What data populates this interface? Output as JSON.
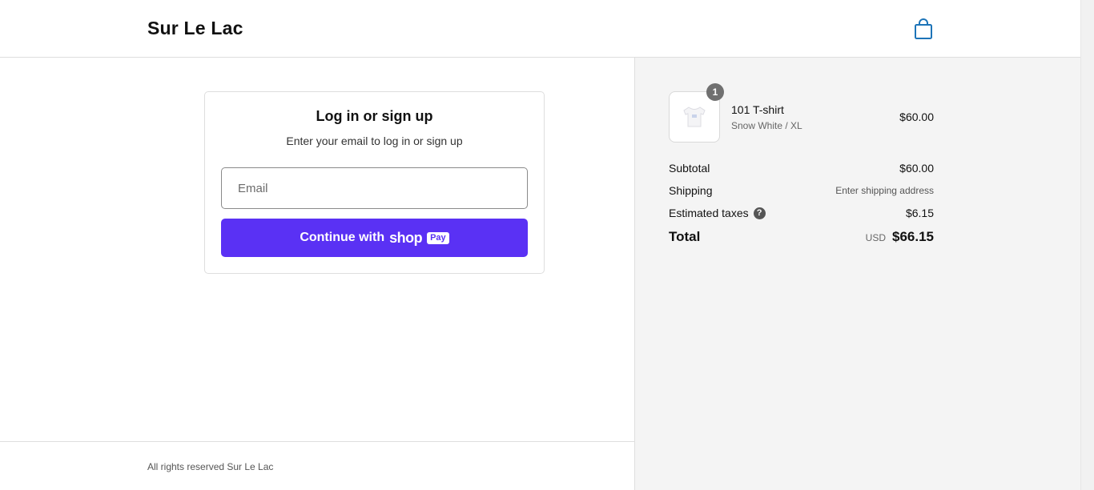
{
  "header": {
    "store_name": "Sur Le Lac",
    "cart_icon": "shopping-bag-icon",
    "accent_color": "#1d74b8"
  },
  "login": {
    "title": "Log in or sign up",
    "subtitle": "Enter your email to log in or sign up",
    "email_placeholder": "Email",
    "email_value": "",
    "button_prefix": "Continue with",
    "button_brand": "shop",
    "button_badge": "Pay",
    "button_color": "#5a31f4"
  },
  "footer": {
    "text": "All rights reserved Sur Le Lac"
  },
  "order": {
    "items": [
      {
        "name": "101 T-shirt",
        "variant": "Snow White / XL",
        "price": "$60.00",
        "quantity": "1",
        "thumb_icon": "t-shirt-icon"
      }
    ],
    "subtotal_label": "Subtotal",
    "subtotal_value": "$60.00",
    "shipping_label": "Shipping",
    "shipping_value": "Enter shipping address",
    "taxes_label": "Estimated taxes",
    "taxes_help": "?",
    "taxes_value": "$6.15",
    "total_label": "Total",
    "currency": "USD",
    "total_value": "$66.15"
  }
}
